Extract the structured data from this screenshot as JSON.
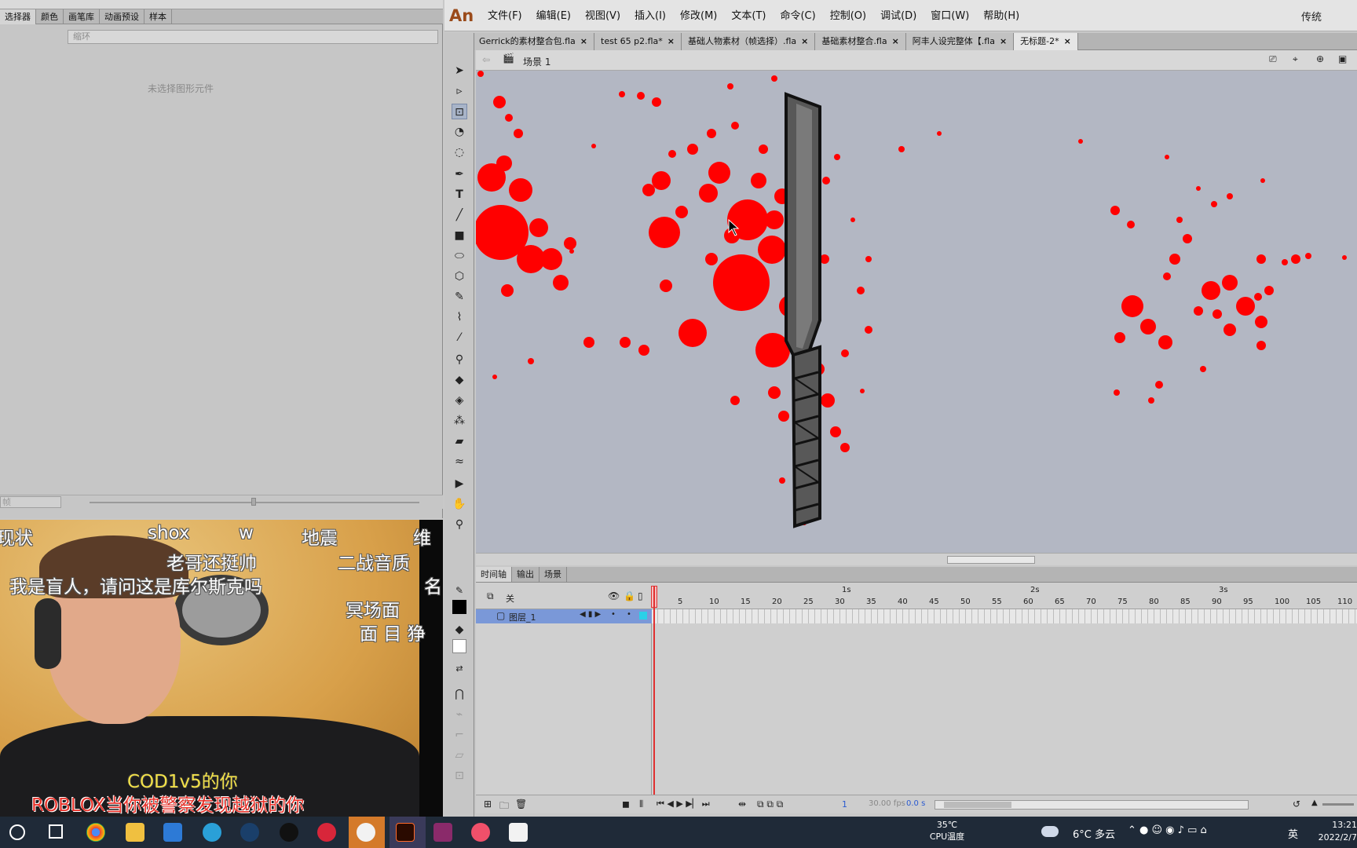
{
  "left_panel": {
    "tabs": [
      "选择器",
      "颜色",
      "画笔库",
      "动画预设",
      "样本"
    ],
    "filter_placeholder": "缩环",
    "empty_message": "未选择图形元件",
    "unit_dropdown": "帧"
  },
  "webcam": {
    "danmaku": [
      "现状",
      "shox",
      "w",
      "地震",
      "维",
      "老哥还挺帅",
      "二战音质",
      "我是盲人，请问这是库尔斯克吗",
      "名",
      "冥场面",
      "面 目 狰",
      "COD1v5的你",
      "ROBLOX当你被警察发现越狱的你"
    ]
  },
  "app": {
    "logo": "An",
    "menu": [
      "文件(F)",
      "编辑(E)",
      "视图(V)",
      "插入(I)",
      "修改(M)",
      "文本(T)",
      "命令(C)",
      "控制(O)",
      "调试(D)",
      "窗口(W)",
      "帮助(H)"
    ],
    "workspace_mode": "传统",
    "doc_tabs": [
      {
        "label": "Gerrick的素材整合包.fla",
        "active": false
      },
      {
        "label": "test 65 p2.fla*",
        "active": false
      },
      {
        "label": "基础人物素材（帧选择）.fla",
        "active": false
      },
      {
        "label": "基础素材整合.fla",
        "active": false
      },
      {
        "label": "阿丰人设完整体【.fla",
        "active": false
      },
      {
        "label": "无标题-2*",
        "active": true
      }
    ],
    "close_glyph": "×",
    "scene_label": "场景 1"
  },
  "timeline": {
    "tabs": [
      "时间轴",
      "输出",
      "场景"
    ],
    "header_label": "关",
    "layer_name": "图层_1",
    "second_markers": [
      "1s",
      "2s",
      "3s"
    ],
    "frame_numbers": [
      "1",
      "5",
      "10",
      "15",
      "20",
      "25",
      "30",
      "35",
      "40",
      "45",
      "50",
      "55",
      "60",
      "65",
      "70",
      "75",
      "80",
      "85",
      "90",
      "95",
      "100",
      "105",
      "110"
    ],
    "current_frame": "1",
    "fps": "30.00 fps",
    "time": "0.0 s"
  },
  "taskbar": {
    "cpu_temp": "35℃",
    "cpu_label": "CPU温度",
    "weather": "6°C 多云",
    "ime": "英",
    "time": "13:21",
    "date": "2022/2/7"
  },
  "colors": {
    "blood": "#ff0000",
    "accent_selection": "#7a98d8",
    "playhead": "#e03030"
  }
}
